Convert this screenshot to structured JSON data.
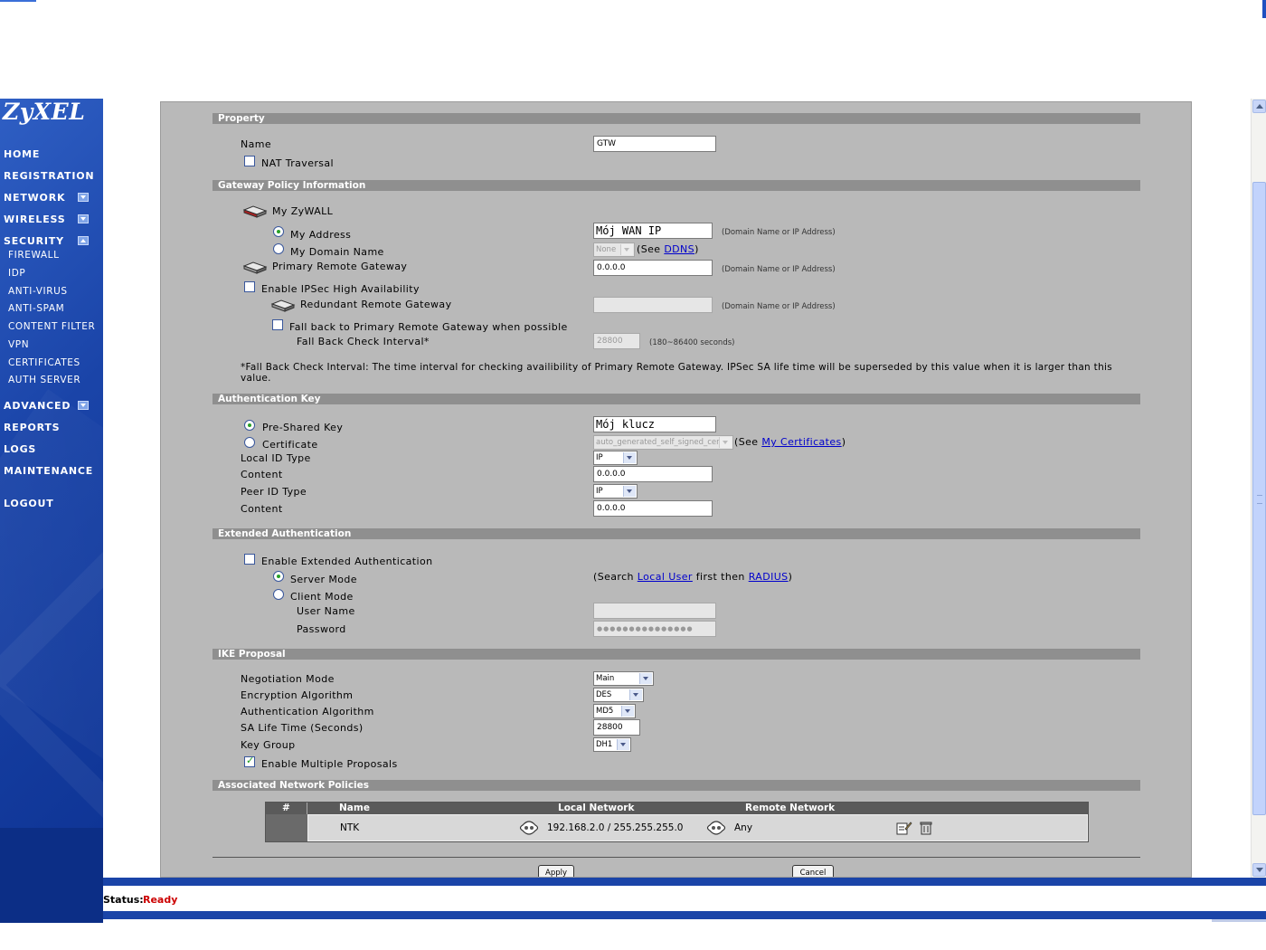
{
  "brand": {
    "logo_text": "ZyXEL",
    "sidebar_color": "#1a44a8"
  },
  "nav": {
    "items": [
      "HOME",
      "REGISTRATION",
      "NETWORK",
      "WIRELESS",
      "SECURITY",
      "ADVANCED",
      "REPORTS",
      "LOGS",
      "MAINTENANCE",
      "LOGOUT"
    ],
    "security_sub": [
      "FIREWALL",
      "IDP",
      "ANTI-VIRUS",
      "ANTI-SPAM",
      "CONTENT FILTER",
      "VPN",
      "CERTIFICATES",
      "AUTH SERVER"
    ]
  },
  "property": {
    "section": "Property",
    "name_label": "Name",
    "name_value": "GTW",
    "nat_label": "NAT Traversal",
    "nat_checked": false
  },
  "gateway": {
    "section": "Gateway Policy Information",
    "my_zywall": "My ZyWALL",
    "my_address_label": "My Address",
    "my_address_value": "Mój WAN IP",
    "my_domain_label": "My Domain Name",
    "domain_select": "None",
    "see_prefix": "(See ",
    "ddns_link": "DDNS",
    "see_suffix": ")",
    "hint_domain_ip": "(Domain Name or IP Address)",
    "primary_label": "Primary Remote Gateway",
    "primary_value": "0.0.0.0",
    "ha_label": "Enable IPSec High Availability",
    "redundant_label": "Redundant Remote Gateway",
    "redundant_value": "",
    "fallback_label": "Fall back to Primary Remote Gateway when possible",
    "interval_label": "Fall Back Check Interval*",
    "interval_value": "28800",
    "interval_hint": "(180~86400 seconds)",
    "note": "*Fall Back Check Interval: The time interval for checking availibility of Primary Remote Gateway. IPSec SA life time will be superseded by this value when it is larger than this value."
  },
  "auth_key": {
    "section": "Authentication Key",
    "psk_label": "Pre-Shared Key",
    "psk_value": "Mój klucz",
    "cert_label": "Certificate",
    "cert_select": "auto_generated_self_signed_cert",
    "see_prefix": "(See ",
    "cert_link": "My Certificates",
    "see_suffix": ")",
    "local_id_type_label": "Local ID Type",
    "local_id_type_value": "IP",
    "local_content_label": "Content",
    "local_content_value": "0.0.0.0",
    "peer_id_type_label": "Peer ID Type",
    "peer_id_type_value": "IP",
    "peer_content_label": "Content",
    "peer_content_value": "0.0.0.0"
  },
  "xauth": {
    "section": "Extended Authentication",
    "enable_label": "Enable Extended Authentication",
    "server_mode_label": "Server Mode",
    "search_prefix": "(Search ",
    "local_user_link": "Local User",
    "search_mid": " first then ",
    "radius_link": "RADIUS",
    "search_suffix": ")",
    "client_mode_label": "Client Mode",
    "user_name_label": "User Name",
    "user_name_value": "",
    "password_label": "Password",
    "password_value": "●●●●●●●●●●●●●●●"
  },
  "ike": {
    "section": "IKE Proposal",
    "negotiation_label": "Negotiation Mode",
    "negotiation_value": "Main",
    "encryption_label": "Encryption Algorithm",
    "encryption_value": "DES",
    "auth_alg_label": "Authentication Algorithm",
    "auth_alg_value": "MD5",
    "sa_life_label": "SA Life Time (Seconds)",
    "sa_life_value": "28800",
    "key_group_label": "Key Group",
    "key_group_value": "DH1",
    "multi_label": "Enable Multiple Proposals",
    "multi_checked": true
  },
  "policies": {
    "section": "Associated Network Policies",
    "headers": [
      "#",
      "Name",
      "Local Network",
      "Remote Network"
    ],
    "rows": [
      {
        "num": "",
        "name": "NTK",
        "local": "192.168.2.0 / 255.255.255.0",
        "remote": "Any"
      }
    ]
  },
  "buttons": {
    "apply": "Apply",
    "cancel": "Cancel"
  },
  "status": {
    "label": "Status:",
    "value": "Ready",
    "value_color": "#cc0000"
  },
  "icons": [
    "device-icon",
    "network-icon",
    "edit-icon",
    "delete-icon"
  ]
}
